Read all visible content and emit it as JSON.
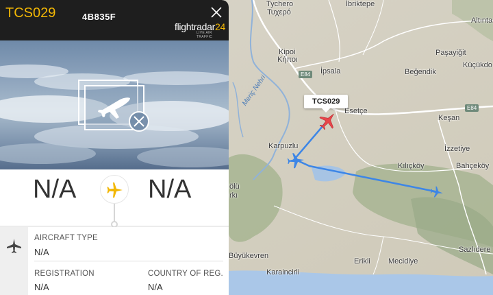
{
  "flight": {
    "callsign": "TCS029",
    "hex_code": "4B835F"
  },
  "brand": {
    "name_part1": "flightradar",
    "name_part2": "24",
    "tagline": "LIVE AIR TRAFFIC"
  },
  "route": {
    "origin": "N/A",
    "destination": "N/A"
  },
  "details": {
    "aircraft_type_label": "AIRCRAFT TYPE",
    "aircraft_type_value": "N/A",
    "registration_label": "REGISTRATION",
    "registration_value": "N/A",
    "country_label": "COUNTRY OF REG.",
    "country_value": "N/A"
  },
  "map": {
    "callsign_tag": "TCS029",
    "places": {
      "tychero": "Tychero",
      "tychero_gr": "Τυχερό",
      "ibriktepe": "İbriktepe",
      "altinta": "Altınta",
      "kipoi": "Kipoi",
      "kipoi_gr": "Κήποι",
      "ipsala": "İpsala",
      "pasayigit": "Paşayiğit",
      "begendik": "Beğendik",
      "kucukdo": "Küçükdo",
      "esetce": "Esetçe",
      "kesan": "Keşan",
      "karpuzlu": "Karpuzlu",
      "izzetiye": "İzzetiye",
      "kilickoy": "Kılıçköy",
      "bahcekoy": "Bahçeköy",
      "buyukevren": "Büyükevren",
      "erikli": "Erikli",
      "mecidiye": "Mecidiye",
      "sazlidere": "Sazlıdere",
      "karaincirli": "Karaincirli",
      "olu": "ölü",
      "rki": "rkı",
      "river": "Meriç Nehri"
    },
    "road_e84_a": "E84",
    "road_e84_b": "E84"
  },
  "colors": {
    "accent": "#f2b705",
    "header_bg": "#1e1e1e",
    "track": "#3d86e6",
    "selected_plane": "#e8454a"
  },
  "icons": {
    "close": "close-icon",
    "photo_unavailable": "photo-unavailable-icon",
    "route_plane": "airplane-icon",
    "aircraft": "airplane-icon"
  }
}
